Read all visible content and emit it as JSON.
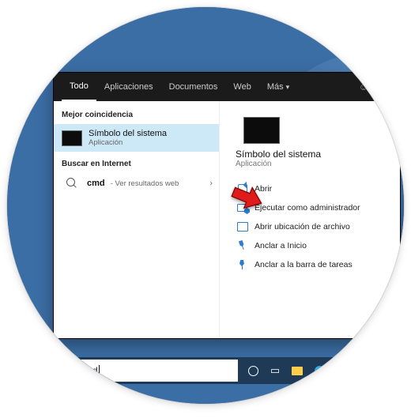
{
  "tabs": {
    "all": "Todo",
    "apps": "Aplicaciones",
    "docs": "Documentos",
    "web": "Web",
    "more": "Más"
  },
  "left": {
    "best_match_label": "Mejor coincidencia",
    "best_match": {
      "title": "Símbolo del sistema",
      "subtitle": "Aplicación"
    },
    "web_label": "Buscar en Internet",
    "web_item": {
      "query": "cmd",
      "suffix": "Ver resultados web"
    }
  },
  "right": {
    "title": "Símbolo del sistema",
    "subtitle": "Aplicación",
    "actions": {
      "open": "Abrir",
      "run_admin": "Ejecutar como administrador",
      "open_location": "Abrir ubicación de archivo",
      "pin_start": "Anclar a Inicio",
      "pin_taskbar": "Anclar a la barra de tareas"
    }
  },
  "search": {
    "query": "cmd"
  }
}
